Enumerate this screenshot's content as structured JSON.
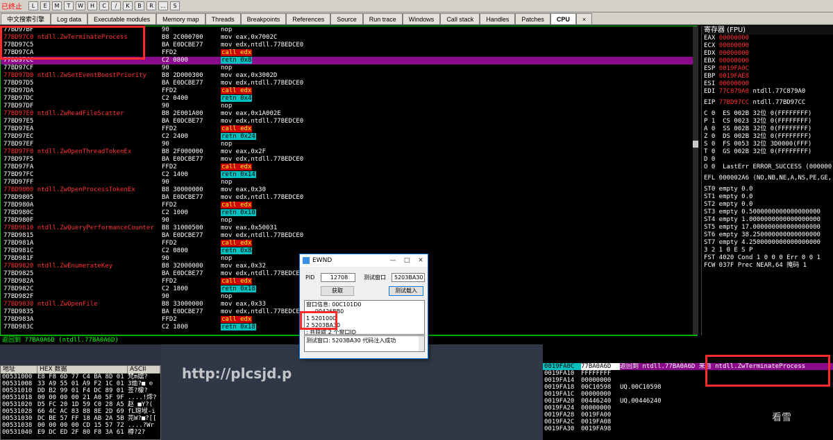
{
  "app": {
    "title": "已终止"
  },
  "toolbar": {
    "buttons": [
      "L",
      "E",
      "M",
      "T",
      "W",
      "H",
      "C",
      "/",
      "K",
      "B",
      "R",
      "...",
      "S"
    ]
  },
  "tabs": [
    {
      "label": "中文搜索引擎",
      "active": false
    },
    {
      "label": "Log data",
      "active": false
    },
    {
      "label": "Executable modules",
      "active": false
    },
    {
      "label": "Memory map",
      "active": false
    },
    {
      "label": "Threads",
      "active": false
    },
    {
      "label": "Breakpoints",
      "active": false
    },
    {
      "label": "References",
      "active": false
    },
    {
      "label": "Source",
      "active": false
    },
    {
      "label": "Run trace",
      "active": false
    },
    {
      "label": "Windows",
      "active": false
    },
    {
      "label": "Call stack",
      "active": false
    },
    {
      "label": "Handles",
      "active": false
    },
    {
      "label": "Patches",
      "active": false
    },
    {
      "label": "CPU",
      "active": true
    },
    {
      "label": "×",
      "active": false
    }
  ],
  "disasm": [
    {
      "addr": "77BD97BF",
      "label": "",
      "bytes": "90",
      "asm": "nop",
      "hl": false,
      "sel": false
    },
    {
      "addr": "77BD97C0",
      "label": "ntdll.ZwTerminateProcess",
      "bytes": "B8 2C000700",
      "asm": "mov eax,0x7002C",
      "hl": true,
      "sel": false
    },
    {
      "addr": "77BD97C5",
      "label": "",
      "bytes": "BA E0DCBE77",
      "asm": "mov edx,ntdll.77BEDCE0",
      "hl": false,
      "sel": false
    },
    {
      "addr": "77BD97CA",
      "label": "",
      "bytes": "FFD2",
      "asm": "call edx",
      "kind": "call",
      "hl": false,
      "sel": false
    },
    {
      "addr": "77BD97CC",
      "label": "",
      "bytes": "C2 0800",
      "asm": "retn 0x8",
      "kind": "retn",
      "hl": false,
      "sel": true
    },
    {
      "addr": "77BD97CF",
      "label": "",
      "bytes": "90",
      "asm": "nop",
      "hl": false,
      "sel": false
    },
    {
      "addr": "77BD97D0",
      "label": "ntdll.ZwSetEventBoostPriority",
      "bytes": "B8 2D000300",
      "asm": "mov eax,0x3002D",
      "hl": true,
      "sel": false
    },
    {
      "addr": "77BD97D5",
      "label": "",
      "bytes": "BA E0DCBE77",
      "asm": "mov edx,ntdll.77BEDCE0",
      "hl": false,
      "sel": false
    },
    {
      "addr": "77BD97DA",
      "label": "",
      "bytes": "FFD2",
      "asm": "call edx",
      "kind": "call",
      "hl": false,
      "sel": false
    },
    {
      "addr": "77BD97DC",
      "label": "",
      "bytes": "C2 0400",
      "asm": "retn 0x4",
      "kind": "retn",
      "hl": false,
      "sel": false
    },
    {
      "addr": "77BD97DF",
      "label": "",
      "bytes": "90",
      "asm": "nop",
      "hl": false,
      "sel": false
    },
    {
      "addr": "77BD97E0",
      "label": "ntdll.ZwReadFileScatter",
      "bytes": "B8 2E001A00",
      "asm": "mov eax,0x1A002E",
      "hl": true,
      "sel": false
    },
    {
      "addr": "77BD97E5",
      "label": "",
      "bytes": "BA E0DCBE77",
      "asm": "mov edx,ntdll.77BEDCE0",
      "hl": false,
      "sel": false
    },
    {
      "addr": "77BD97EA",
      "label": "",
      "bytes": "FFD2",
      "asm": "call edx",
      "kind": "call",
      "hl": false,
      "sel": false
    },
    {
      "addr": "77BD97EC",
      "label": "",
      "bytes": "C2 2400",
      "asm": "retn 0x24",
      "kind": "retn",
      "hl": false,
      "sel": false
    },
    {
      "addr": "77BD97EF",
      "label": "",
      "bytes": "90",
      "asm": "nop",
      "hl": false,
      "sel": false
    },
    {
      "addr": "77BD97F0",
      "label": "ntdll.ZwOpenThreadTokenEx",
      "bytes": "B8 2F000000",
      "asm": "mov eax,0x2F",
      "hl": true,
      "sel": false
    },
    {
      "addr": "77BD97F5",
      "label": "",
      "bytes": "BA E0DCBE77",
      "asm": "mov edx,ntdll.77BEDCE0",
      "hl": false,
      "sel": false
    },
    {
      "addr": "77BD97FA",
      "label": "",
      "bytes": "FFD2",
      "asm": "call edx",
      "kind": "call",
      "hl": false,
      "sel": false
    },
    {
      "addr": "77BD97FC",
      "label": "",
      "bytes": "C2 1400",
      "asm": "retn 0x14",
      "kind": "retn",
      "hl": false,
      "sel": false
    },
    {
      "addr": "77BD97FF",
      "label": "",
      "bytes": "90",
      "asm": "nop",
      "hl": false,
      "sel": false
    },
    {
      "addr": "77BD9800",
      "label": "ntdll.ZwOpenProcessTokenEx",
      "bytes": "B8 30000000",
      "asm": "mov eax,0x30",
      "hl": true,
      "sel": false
    },
    {
      "addr": "77BD9805",
      "label": "",
      "bytes": "BA E0DCBE77",
      "asm": "mov edx,ntdll.77BEDCE0",
      "hl": false,
      "sel": false
    },
    {
      "addr": "77BD980A",
      "label": "",
      "bytes": "FFD2",
      "asm": "call edx",
      "kind": "call",
      "hl": false,
      "sel": false
    },
    {
      "addr": "77BD980C",
      "label": "",
      "bytes": "C2 1000",
      "asm": "retn 0x10",
      "kind": "retn",
      "hl": false,
      "sel": false
    },
    {
      "addr": "77BD980F",
      "label": "",
      "bytes": "90",
      "asm": "nop",
      "hl": false,
      "sel": false
    },
    {
      "addr": "77BD9810",
      "label": "ntdll.ZwQueryPerformanceCounter",
      "bytes": "B8 31000500",
      "asm": "mov eax,0x50031",
      "hl": true,
      "sel": false
    },
    {
      "addr": "77BD9815",
      "label": "",
      "bytes": "BA E0DCBE77",
      "asm": "mov edx,ntdll.77BEDCE0",
      "hl": false,
      "sel": false
    },
    {
      "addr": "77BD981A",
      "label": "",
      "bytes": "FFD2",
      "asm": "call edx",
      "kind": "call",
      "hl": false,
      "sel": false
    },
    {
      "addr": "77BD981C",
      "label": "",
      "bytes": "C2 0800",
      "asm": "retn 0x8",
      "kind": "retn",
      "hl": false,
      "sel": false
    },
    {
      "addr": "77BD981F",
      "label": "",
      "bytes": "90",
      "asm": "nop",
      "hl": false,
      "sel": false
    },
    {
      "addr": "77BD9820",
      "label": "ntdll.ZwEnumerateKey",
      "bytes": "B8 32000000",
      "asm": "mov eax,0x32",
      "hl": true,
      "sel": false
    },
    {
      "addr": "77BD9825",
      "label": "",
      "bytes": "BA E0DCBE77",
      "asm": "mov edx,ntdll.77BEDCE0",
      "hl": false,
      "sel": false
    },
    {
      "addr": "77BD982A",
      "label": "",
      "bytes": "FFD2",
      "asm": "call edx",
      "kind": "call",
      "hl": false,
      "sel": false
    },
    {
      "addr": "77BD982C",
      "label": "",
      "bytes": "C2 1800",
      "asm": "retn 0x18",
      "kind": "retn",
      "hl": false,
      "sel": false
    },
    {
      "addr": "77BD982F",
      "label": "",
      "bytes": "90",
      "asm": "nop",
      "hl": false,
      "sel": false
    },
    {
      "addr": "77BD9830",
      "label": "ntdll.ZwOpenFile",
      "bytes": "B8 33000000",
      "asm": "mov eax,0x33",
      "hl": true,
      "sel": false
    },
    {
      "addr": "77BD9835",
      "label": "",
      "bytes": "BA E0DCBE77",
      "asm": "mov edx,ntdll.77BEDCE0",
      "hl": false,
      "sel": false
    },
    {
      "addr": "77BD983A",
      "label": "",
      "bytes": "FFD2",
      "asm": "call edx",
      "kind": "call",
      "hl": false,
      "sel": false
    },
    {
      "addr": "77BD983C",
      "label": "",
      "bytes": "C2 1800",
      "asm": "retn 0x18",
      "kind": "retn",
      "hl": false,
      "sel": false
    }
  ],
  "info_line": "返回到 77BA0A6D (ntdll.77BA0A6D)",
  "registers": {
    "title": "寄存器 (FPU)",
    "gpr": [
      {
        "n": "EAX",
        "v": "00000000",
        "x": ""
      },
      {
        "n": "ECX",
        "v": "00000000",
        "x": ""
      },
      {
        "n": "EDX",
        "v": "00000000",
        "x": ""
      },
      {
        "n": "EBX",
        "v": "00000000",
        "x": ""
      },
      {
        "n": "ESP",
        "v": "0019FA0C",
        "x": ""
      },
      {
        "n": "EBP",
        "v": "0019FAE8",
        "x": ""
      },
      {
        "n": "ESI",
        "v": "00000000",
        "x": ""
      },
      {
        "n": "EDI",
        "v": "77C879A0",
        "x": "ntdll.77C879A0"
      }
    ],
    "eip": {
      "n": "EIP",
      "v": "77BD97CC",
      "x": "ntdll.77BD97CC"
    },
    "flags": [
      "C 0  ES 002B 32位 0(FFFFFFFF)",
      "P 1  CS 0023 32位 0(FFFFFFFF)",
      "A 0  SS 002B 32位 0(FFFFFFFF)",
      "Z 0  DS 002B 32位 0(FFFFFFFF)",
      "S 0  FS 0053 32位 3D0000(FFF)",
      "T 0  GS 002B 32位 0(FFFFFFFF)",
      "D 0",
      "O 0  LastErr ERROR_SUCCESS (000000"
    ],
    "efl": "EFL 000002A6 (NO,NB,NE,A,NS,PE,GE,",
    "fpu": [
      "ST0 empty 0.0",
      "ST1 empty 0.0",
      "ST2 empty 0.0",
      "ST3 empty 0.5000000000000000000",
      "ST4 empty 1.0000000000000000000",
      "ST5 empty 17.000000000000000000",
      "ST6 empty 38.250000000000000000",
      "ST7 empty 4.2500000000000000000"
    ],
    "fst_hdr": "              3 2 1 0      E S P",
    "fst": "FST 4020  Cond 1 0 0 0  Err 0 0 1",
    "fcw": "FCW 037F  Prec NEAR,64  掩码    1"
  },
  "dump": {
    "headers": {
      "addr": "地址",
      "hex": "HEX 数据",
      "ascii": "ASCII"
    },
    "rows": [
      {
        "a": "00531000",
        "h": "E8 F8 6D 77 C4 BA 8D 01",
        "s": "梵m嬬?"
      },
      {
        "a": "00531008",
        "h": "33 A9 55 01 A9 F2 1C 01",
        "s": "3烅?■ ⊙"
      },
      {
        "a": "00531010",
        "h": "DD B2 99 01 F4 DC 89 01",
        "s": "莶?檬?"
      },
      {
        "a": "00531018",
        "h": "00 00 00 00 21 A0 5F 9F",
        "s": "....!燯?"
      },
      {
        "a": "00531020",
        "h": "D5 FC 20 1D 59 C0 28 A5",
        "s": "赵 ■Y?("
      },
      {
        "a": "00531028",
        "h": "66 4C AC 83 88 8E 2D 69",
        "s": "fL瑺垘-i"
      },
      {
        "a": "00531030",
        "h": "DC BE 57 FF 18 AB 2A 5B",
        "s": "芫W?■?[["
      },
      {
        "a": "00531038",
        "h": "00 00 00 00 CD 15 57 72",
        "s": "....?Wr"
      },
      {
        "a": "00531040",
        "h": "E9 DC ED 2F 80 F8 3A 61",
        "s": "樽?2?"
      }
    ]
  },
  "stack": [
    {
      "a": "0019FA0C",
      "v": "77BA0A6D",
      "c": "返回到 ntdll.77BA0A6D 来自 ntdll.ZwTerminateProcess",
      "top": true
    },
    {
      "a": "0019FA10",
      "v": "FFFFFFFF",
      "c": "",
      "top": false
    },
    {
      "a": "0019FA14",
      "v": "00000000",
      "c": "",
      "top": false
    },
    {
      "a": "0019FA18",
      "v": "00C10598",
      "c": "UQ.00C10598",
      "top": false
    },
    {
      "a": "0019FA1C",
      "v": "00000000",
      "c": "",
      "top": false
    },
    {
      "a": "0019FA20",
      "v": "00446240",
      "c": "UQ.00446240",
      "top": false
    },
    {
      "a": "0019FA24",
      "v": "00000000",
      "c": "",
      "top": false
    },
    {
      "a": "0019FA28",
      "v": "0019FA00",
      "c": "",
      "top": false
    },
    {
      "a": "0019FA2C",
      "v": "0019FA08",
      "c": "",
      "top": false
    },
    {
      "a": "0019FA30",
      "v": "0019FA98",
      "c": "",
      "top": false
    }
  ],
  "dialog": {
    "title": "EWND",
    "pid_label": "PID",
    "pid_value": "12708",
    "test_label": "测试窗口",
    "test_value": "5203BA30",
    "btn_get": "获取",
    "btn_test": "测试载入",
    "list_lines": [
      "窗口信息: 00C101D0",
      "     00426BB0",
      "1 5201000",
      "2 5203BA30",
      "; 共获取 2 个窗口ID"
    ],
    "status_text": "测试窗口: 5203BA30 代码注入成功"
  },
  "desktop": {
    "url_text": "http://plcsjd.p",
    "watermark": "看雪"
  }
}
